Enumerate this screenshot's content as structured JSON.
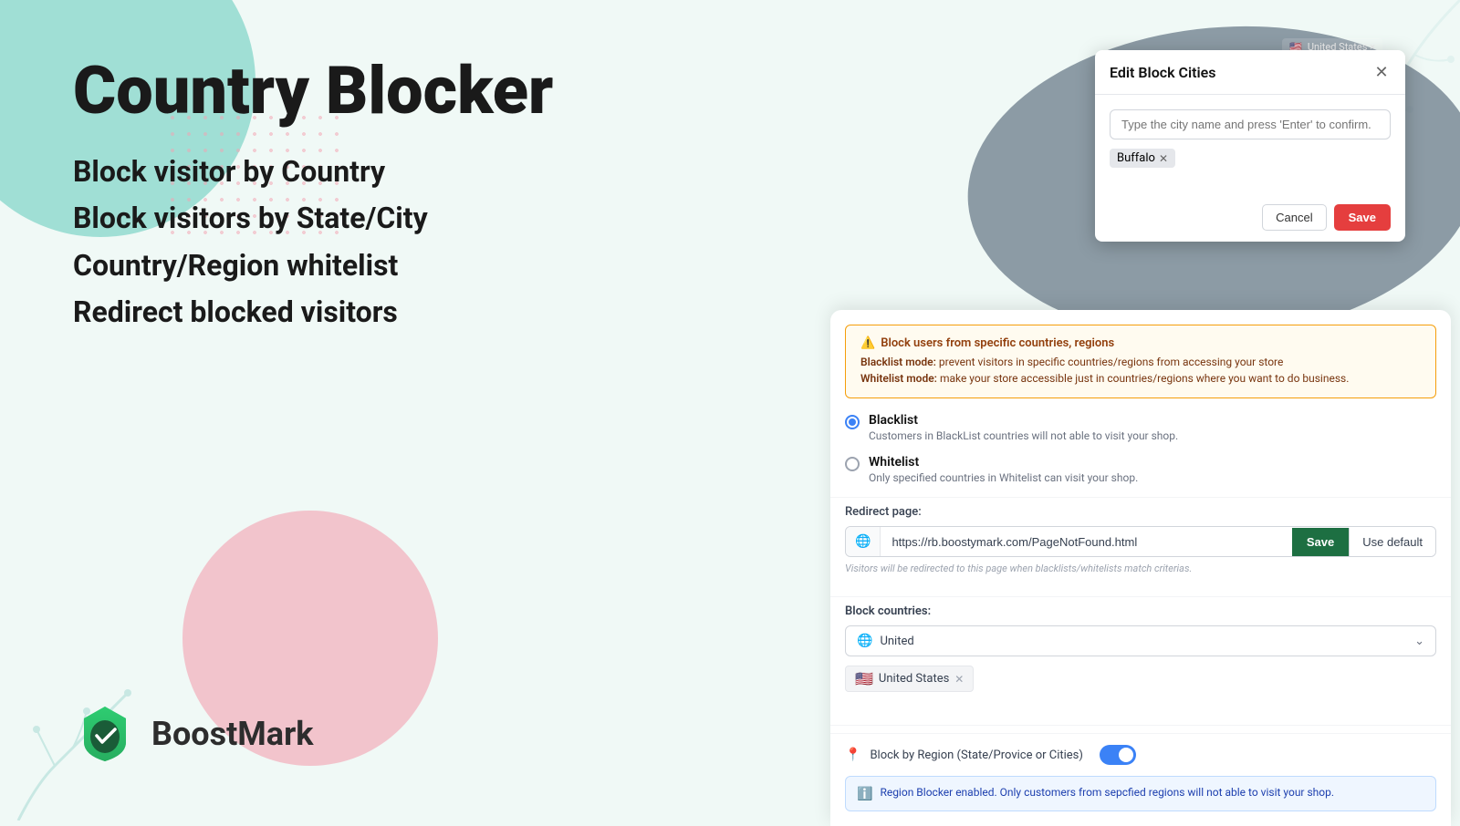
{
  "app": {
    "title": "Country Blocker",
    "features": [
      "Block visitor by Country",
      "Block visitors by State/City",
      "Country/Region whitelist",
      "Redirect blocked visitors"
    ],
    "logo_text": "BoostMark"
  },
  "dialog": {
    "title": "Edit Block Cities",
    "input_placeholder": "Type the city name and press 'Enter' to confirm.",
    "tag": "Buffalo",
    "cancel_btn": "Cancel",
    "save_btn": "Save"
  },
  "main_ui": {
    "warning": {
      "title": "Block users from specific countries, regions",
      "blacklist_mode": "Blacklist mode: prevent visitors in specific countries/regions from accessing your store",
      "whitelist_mode": "Whitelist mode: make your store accessible just in countries/regions where you want to do business."
    },
    "radio": {
      "blacklist_label": "Blacklist",
      "blacklist_desc": "Customers in BlackList countries will not able to visit your shop.",
      "whitelist_label": "Whitelist",
      "whitelist_desc": "Only specified countries in Whitelist can visit your shop."
    },
    "redirect": {
      "label": "Redirect page:",
      "url": "https://rb.boostymark.com/PageNotFound.html",
      "save_btn": "Save",
      "use_default_btn": "Use default",
      "hint": "Visitors will be redirected to this page when blacklists/whitelists match criterias."
    },
    "block_countries": {
      "label": "Block countries:",
      "search_placeholder": "United",
      "tag_country": "United States",
      "tag_flag": "🇺🇸"
    },
    "region": {
      "label": "Block by Region (State/Provice or Cities)",
      "toggle_on": true
    },
    "info_banner": {
      "text": "Region Blocker enabled. Only customers from sepcfied regions will not able to visit your shop."
    }
  },
  "oval_area": {
    "us_tag": "United States  ×",
    "region_label": "Block by Region (State/Provice or Cities)",
    "region_enabled": true,
    "info_text": "Region Blocker enabled. Only customers from sepcfied regions will not able to visit your shop."
  }
}
